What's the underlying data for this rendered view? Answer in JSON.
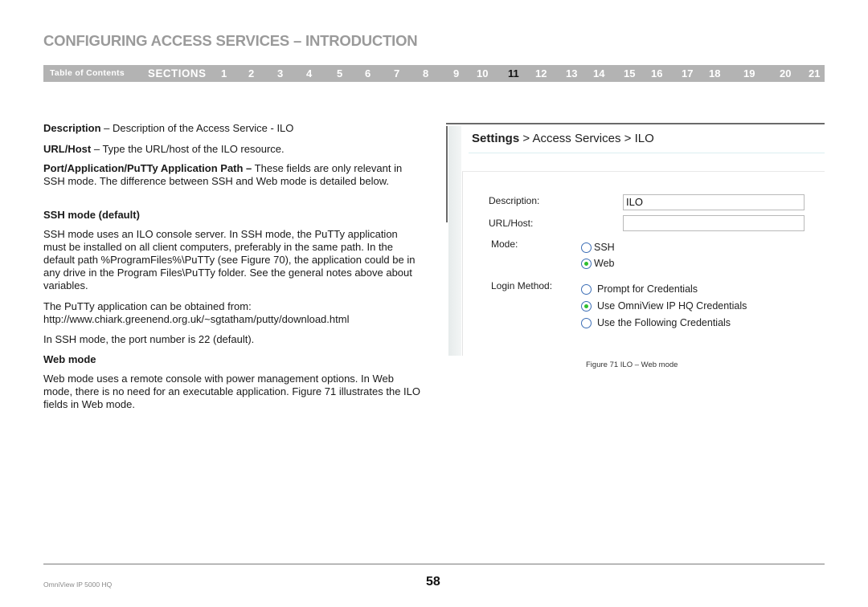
{
  "header": {
    "title": "CONFIGURING ACCESS SERVICES – INTRODUCTION"
  },
  "navbar": {
    "toc_label": "Table of Contents",
    "sections_label": "SECTIONS",
    "sections": [
      "1",
      "2",
      "3",
      "4",
      "5",
      "6",
      "7",
      "8",
      "9",
      "10",
      "11",
      "12",
      "13",
      "14",
      "15",
      "16",
      "17",
      "18",
      "19",
      "20",
      "21"
    ],
    "active_section": "11"
  },
  "body": {
    "description": {
      "term": "Description",
      "text": " – Description of the Access Service - ILO"
    },
    "url_host": {
      "term": "URL/Host",
      "text": " – Type the URL/host of the ILO resource."
    },
    "port_app": {
      "term": "Port/Application/PuTTy Application Path –",
      "text": " These fields are only relevant in SSH mode. The difference between SSH and Web mode is detailed below."
    },
    "ssh_heading": "SSH mode (default)",
    "ssh_text": "SSH mode uses an ILO console server. In SSH mode, the PuTTy application must be installed on all client computers, preferably in the same path. In the default path %ProgramFiles%\\PuTTy (see Figure 70), the application could be in any drive in the Program Files\\PuTTy folder. See the general notes above about variables.",
    "putty_line1": "The PuTTy application can be obtained from:",
    "putty_url": "http://www.chiark.greenend.org.uk/~sgtatham/putty/download.html",
    "ssh_port": "In SSH mode, the port number is 22 (default).",
    "web_heading": "Web mode",
    "web_text": "Web mode uses a remote console with power management options. In Web mode, there is no need for an executable application. Figure 71 illustrates the ILO fields in Web mode."
  },
  "figure": {
    "breadcrumb_root": "Settings",
    "breadcrumb_rest": " > Access Services > ILO",
    "description_label": "Description:",
    "description_value": "ILO",
    "url_label": "URL/Host:",
    "url_value": "",
    "mode_label": "Mode:",
    "mode_options": [
      {
        "label": "SSH",
        "checked": false
      },
      {
        "label": "Web",
        "checked": true
      }
    ],
    "login_label": "Login Method:",
    "login_options": [
      {
        "label": "Prompt for Credentials",
        "checked": false
      },
      {
        "label": "Use OmniView IP HQ Credentials",
        "checked": true
      },
      {
        "label": "Use the Following Credentials",
        "checked": false
      }
    ],
    "caption": "Figure 71 ILO – Web mode"
  },
  "footer": {
    "product": "OmniView IP 5000 HQ",
    "page_number": "58"
  }
}
